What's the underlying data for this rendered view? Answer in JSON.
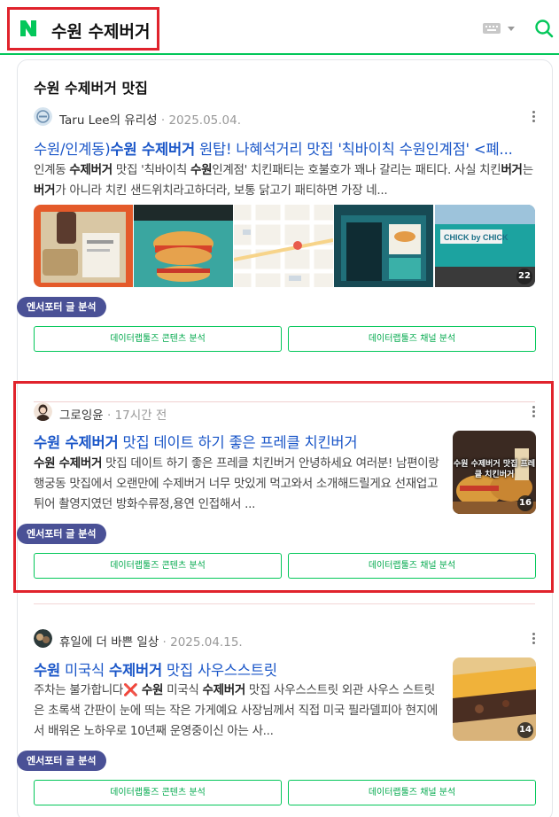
{
  "header": {
    "query": "수원 수제버거",
    "logo": "naver-n-logo",
    "accent": "#03c75a",
    "highlight": "#e0232c"
  },
  "section": {
    "title": "수원 수제버거 맛집"
  },
  "buttons": {
    "tag": "엔서포터 글 분석",
    "content_analysis": "데이터랩툴즈 콘텐츠 분석",
    "channel_analysis": "데이터랩툴즈 채널 분석"
  },
  "posts": [
    {
      "author": "Taru Lee의 유리성",
      "date": "2025.05.04.",
      "title": [
        {
          "t": "수원/인계동)",
          "b": false
        },
        {
          "t": "수원 수제버거",
          "b": true
        },
        {
          "t": " 원탑! 나혜석거리 맛집 '칙바이칙 수원인계점' <폐...",
          "b": false
        }
      ],
      "desc": [
        {
          "t": "인계동 ",
          "b": false
        },
        {
          "t": "수제버거",
          "b": true
        },
        {
          "t": " 맛집 '칙바이칙 ",
          "b": false
        },
        {
          "t": "수원",
          "b": true
        },
        {
          "t": "인계점' 치킨패티는 호불호가 꽤나 갈리는 패티다. 사실 치킨",
          "b": false
        },
        {
          "t": "버거",
          "b": true
        },
        {
          "t": "는 ",
          "b": false
        },
        {
          "t": "버거",
          "b": true
        },
        {
          "t": "가 아니라 치킨 샌드위치라고하더라, 보통 닭고기 패티하면 가장 네...",
          "b": false
        }
      ],
      "image_count": "22"
    },
    {
      "author": "그로잉윤",
      "date": "17시간 전",
      "title": [
        {
          "t": "수원 수제버거",
          "b": true
        },
        {
          "t": " 맛집 데이트 하기 좋은 프레클 치킨버거",
          "b": false
        }
      ],
      "desc": [
        {
          "t": "수원 수제버거",
          "b": true
        },
        {
          "t": " 맛집 데이트 하기 좋은 프레클 치킨버거 안녕하세요 여러분! 남편이랑 행궁동 맛집에서 오랜만에 수제버거 너무 맛있게 먹고와서 소개해드릴게요 선재업고튀어 촬영지였던 방화수류정,용연 인접해서 ...",
          "b": false
        }
      ],
      "thumb_caption": "수원 수제버거 맛집 프레클 치킨버거",
      "image_count": "16"
    },
    {
      "author": "휴일에 더 바쁜 일상",
      "date": "2025.04.15.",
      "title": [
        {
          "t": "수원",
          "b": true
        },
        {
          "t": " 미국식 ",
          "b": false
        },
        {
          "t": "수제버거",
          "b": true
        },
        {
          "t": " 맛집 사우스스트릿",
          "b": false
        }
      ],
      "desc": [
        {
          "t": "주차는 불가합니다",
          "b": false
        },
        {
          "t": "❌",
          "b": false
        },
        {
          "t": " 수원",
          "b": true
        },
        {
          "t": " 미국식 ",
          "b": false
        },
        {
          "t": "수제버거",
          "b": true
        },
        {
          "t": " 맛집 사우스스트릿 외관 사우스 스트릿은 초록색 간판이 눈에 띄는 작은 가게예요 사장님께서 직접 미국 필라델피아 현지에서 배워온 노하우로 10년째 운영중이신 아는 사...",
          "b": false
        }
      ],
      "image_count": "14"
    }
  ]
}
